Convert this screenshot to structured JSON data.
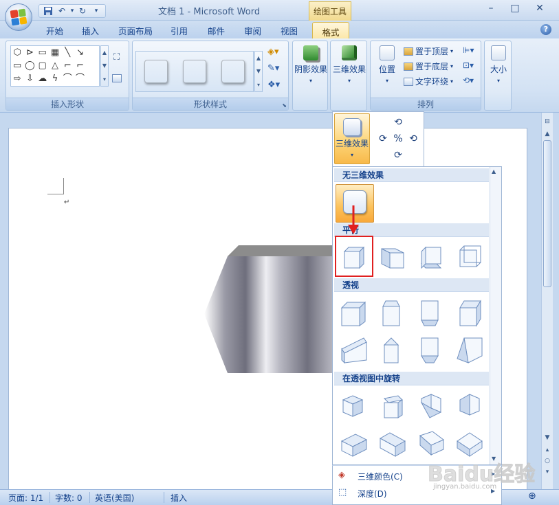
{
  "window": {
    "title": "文档 1 - Microsoft Word",
    "context_tools": "绘图工具",
    "controls": [
      "–",
      "□",
      "✕"
    ]
  },
  "qat": {
    "undo_dropdown": "▾",
    "customize": "▾"
  },
  "tabs": [
    {
      "label": "开始"
    },
    {
      "label": "插入"
    },
    {
      "label": "页面布局"
    },
    {
      "label": "引用"
    },
    {
      "label": "邮件"
    },
    {
      "label": "审阅"
    },
    {
      "label": "视图"
    }
  ],
  "active_tab": {
    "label": "格式"
  },
  "help": "?",
  "ribbon": {
    "insert_shapes": {
      "label": "插入形状",
      "glyphs": [
        "⬡",
        "⊳",
        "▭",
        "▦",
        "╲",
        "↘",
        "",
        "▭",
        "◯",
        "▢",
        "△",
        "⌐",
        "⌐",
        "",
        "⇨",
        "⇩",
        "☁",
        "ϟ",
        "⌒",
        "⌒",
        ""
      ]
    },
    "shape_styles": {
      "label": "形状样式",
      "swatches": [
        "#000000",
        "#4f81bd",
        "#c0504d"
      ]
    },
    "shadow": {
      "label": "阴影效果"
    },
    "effect3d": {
      "label": "三维效果"
    },
    "arrange": {
      "label": "排列",
      "position": "位置",
      "bring_front": "置于顶层",
      "send_back": "置于底层",
      "text_wrap": "文字环绕"
    },
    "size": {
      "label": "大小"
    }
  },
  "popup": {
    "effect3d_btn": "三维效果",
    "sections": {
      "none": "无三维效果",
      "parallel": "平行",
      "perspective": "透视",
      "rotate_perspective": "在透视图中旋转"
    },
    "menu": [
      {
        "label": "三维颜色(C)",
        "icon": "paint-bucket-icon"
      },
      {
        "label": "深度(D)",
        "icon": "depth-icon"
      }
    ]
  },
  "statusbar": {
    "page": "页面: 1/1",
    "words": "字数: 0",
    "language": "英语(美国)",
    "mode": "插入"
  },
  "watermark": {
    "text": "Baidu经验",
    "url": "jingyan.baidu.com"
  },
  "colors": {
    "accent": "#15428b",
    "selection": "#f8b94a",
    "highlight": "#e02020"
  }
}
